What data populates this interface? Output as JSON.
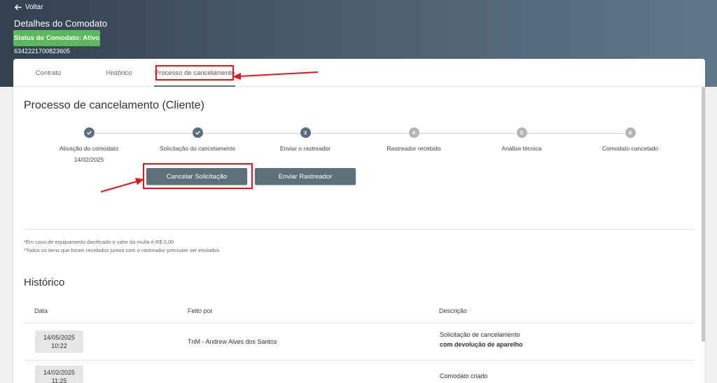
{
  "header": {
    "back_label": "Voltar",
    "title": "Detalhes do Comodato",
    "status_badge": "Status do Comodato: Ativo",
    "serial": "6342221700823605"
  },
  "tabs": [
    {
      "label": "Contrato",
      "active": false
    },
    {
      "label": "Histórico",
      "active": false
    },
    {
      "label": "Processo de cancelamento",
      "active": true
    }
  ],
  "process": {
    "title": "Processo de cancelamento (Cliente)",
    "steps": [
      {
        "number": "1",
        "label": "Ativação do comodato",
        "date": "14/02/2025",
        "done": true
      },
      {
        "number": "2",
        "label": "Solicitação do cancelamento",
        "date": "",
        "done": true
      },
      {
        "number": "3",
        "label": "Enviar o rastreador",
        "date": "",
        "done": false,
        "current": true
      },
      {
        "number": "4",
        "label": "Rastreador recebido",
        "date": "",
        "done": false
      },
      {
        "number": "5",
        "label": "Análise técnica",
        "date": "",
        "done": false
      },
      {
        "number": "6",
        "label": "Comodato cancelado",
        "date": "",
        "done": false
      }
    ],
    "cancel_button": "Cancelar Solicitação",
    "send_button": "Enviar Rastreador",
    "notes": [
      "*Em caso de equipamento danificado o valor da multa é R$ 0,00",
      "*Todos os itens que foram recebidos juntos com o rastreador precisam ser enviados"
    ]
  },
  "history": {
    "title": "Histórico",
    "columns": [
      "Data",
      "Feito por",
      "Descrição"
    ],
    "rows": [
      {
        "date": "14/05/2025",
        "time": "10:22",
        "by": "TnM - Andrew Alves dos Santos",
        "desc": "Solicitação de cancelamento",
        "desc_bold": "com devolução de aparelho"
      },
      {
        "date": "14/02/2025",
        "time": "11:25",
        "by": "",
        "desc": "Comodato criado",
        "desc_bold": ""
      }
    ]
  },
  "colors": {
    "accent": "#5d6f7b",
    "status_green": "#5cb85c",
    "step_done": "#5a6e7c",
    "step_pending": "#b5b5b5",
    "annotation_red": "#e8141c"
  }
}
